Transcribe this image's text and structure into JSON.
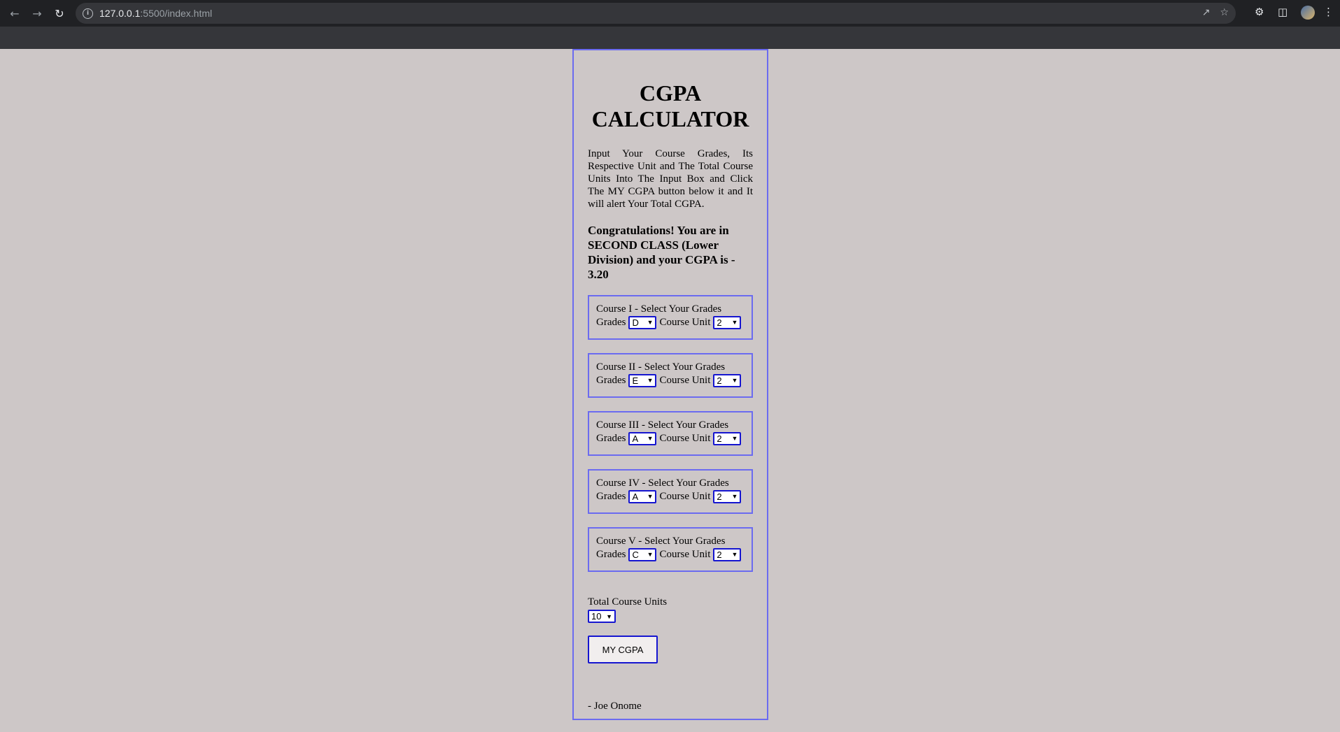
{
  "browser": {
    "url_host": "127.0.0.1",
    "url_rest": ":5500/index.html"
  },
  "page": {
    "title": "CGPA CALCULATOR",
    "intro": "Input Your Course Grades, Its Respective Unit and The Total Course Units Into The Input Box and Click The MY CGPA button below it and It will alert Your Total CGPA.",
    "result": "Congratulations! You are in SECOND CLASS (Lower Division) and your CGPA is - 3.20",
    "grades_label": "Grades",
    "unit_label": "Course Unit",
    "courses": [
      {
        "title": "Course I - Select Your Grades",
        "grade": "D",
        "unit": "2"
      },
      {
        "title": "Course II - Select Your Grades",
        "grade": "E",
        "unit": "2"
      },
      {
        "title": "Course III - Select Your Grades",
        "grade": "A",
        "unit": "2"
      },
      {
        "title": "Course IV - Select Your Grades",
        "grade": "A",
        "unit": "2"
      },
      {
        "title": "Course V - Select Your Grades",
        "grade": "C",
        "unit": "2"
      }
    ],
    "total_label": "Total Course Units",
    "total_value": "10",
    "button_label": "MY CGPA",
    "author": "- Joe Onome"
  },
  "colors": {
    "page_bg": "#cdc7c7",
    "border_accent": "#6b6bf0",
    "select_border": "#1515d0"
  }
}
